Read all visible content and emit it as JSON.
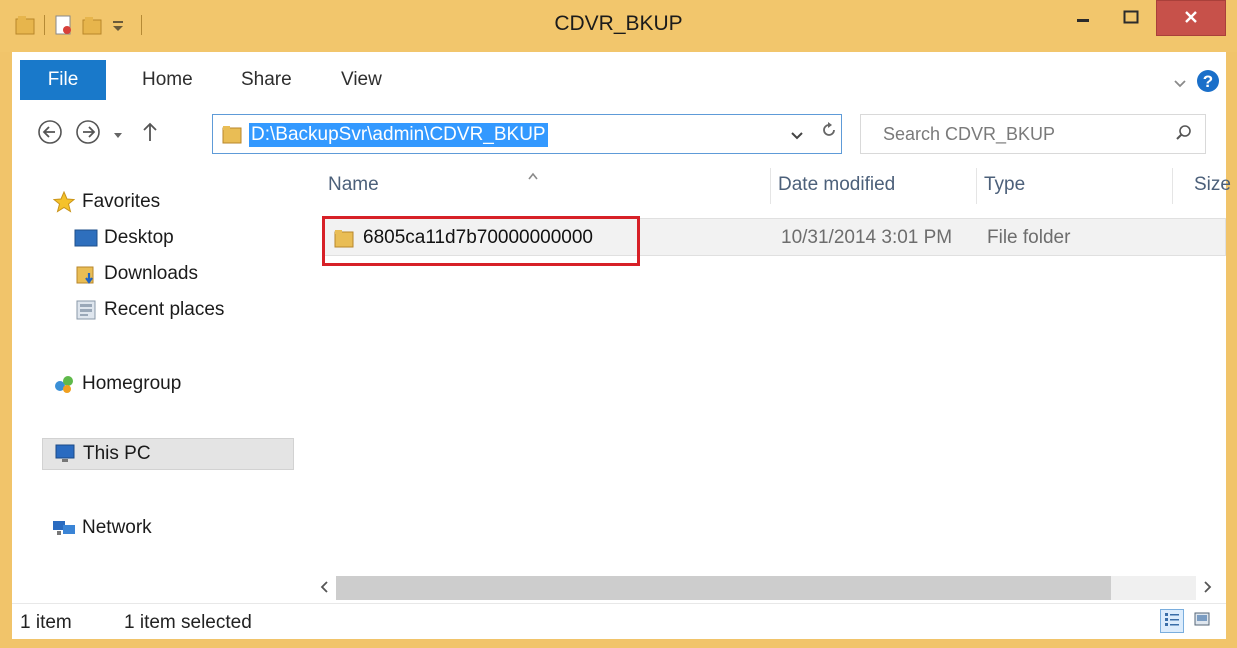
{
  "window": {
    "title": "CDVR_BKUP",
    "colors": {
      "frame": "#f2c66c",
      "close": "#c7514a",
      "file_tab": "#1979ca",
      "selection": "#3399ff",
      "highlight": "#d72027"
    }
  },
  "quick_access": [
    "folder-properties-icon",
    "new-document-icon",
    "new-folder-icon",
    "customize-dropdown-icon"
  ],
  "ribbon": {
    "tabs": [
      {
        "label": "File"
      },
      {
        "label": "Home"
      },
      {
        "label": "Share"
      },
      {
        "label": "View"
      }
    ]
  },
  "address": {
    "path": "D:\\BackupSvr\\admin\\CDVR_BKUP"
  },
  "search": {
    "placeholder": "Search CDVR_BKUP"
  },
  "nav_pane": {
    "favorites": "Favorites",
    "desktop": "Desktop",
    "downloads": "Downloads",
    "recent": "Recent places",
    "homegroup": "Homegroup",
    "this_pc": "This PC",
    "network": "Network"
  },
  "columns": {
    "name": "Name",
    "date": "Date modified",
    "type": "Type",
    "size": "Size"
  },
  "files": [
    {
      "name": "6805ca11d7b70000000000",
      "date": "10/31/2014 3:01 PM",
      "type": "File folder"
    }
  ],
  "status": {
    "count": "1 item",
    "selected": "1 item selected"
  }
}
